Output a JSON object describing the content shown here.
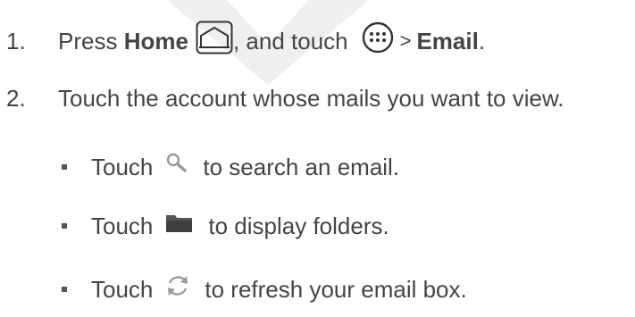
{
  "steps": [
    {
      "number": "1.",
      "press": "Press",
      "home": "Home",
      "mid": ", and touch",
      "sep": ">",
      "email": "Email",
      "end": "."
    },
    {
      "number": "2.",
      "text": "Touch the account whose mails you want to view."
    }
  ],
  "bullets": [
    {
      "before": "Touch",
      "after": "to search an email.",
      "icon": "search-icon"
    },
    {
      "before": "Touch",
      "after": "to display folders.",
      "icon": "folder-icon"
    },
    {
      "before": "Touch",
      "after": "to refresh your email box.",
      "icon": "refresh-icon"
    }
  ],
  "icons": {
    "home": "home-icon",
    "apps": "apps-icon"
  },
  "colors": {
    "text": "#444444",
    "watermark": "#e2e2e2"
  }
}
